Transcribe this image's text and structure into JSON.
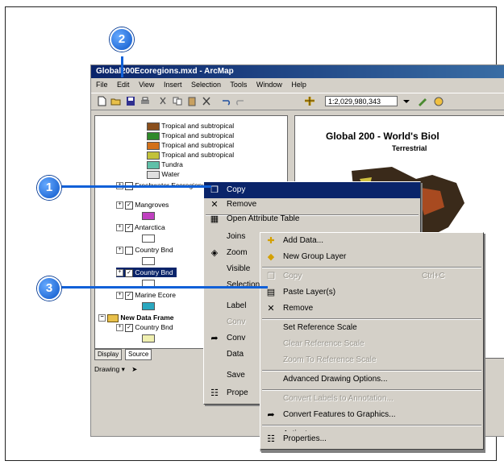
{
  "window": {
    "title": "Global200Ecoregions.mxd - ArcMap",
    "menus": [
      "File",
      "Edit",
      "View",
      "Insert",
      "Selection",
      "Tools",
      "Window",
      "Help"
    ],
    "scale_value": "1:2,029,980,343"
  },
  "toc": {
    "legend_items": [
      {
        "label": "Tropical and subtropical",
        "color": "#8a4f1c"
      },
      {
        "label": "Tropical and subtropical",
        "color": "#2f8a2a"
      },
      {
        "label": "Tropical and subtropical",
        "color": "#d2701a"
      },
      {
        "label": "Tropical and subtropical",
        "color": "#c2c23a"
      },
      {
        "label": "Tundra",
        "color": "#60c0a8"
      },
      {
        "label": "Water",
        "color": "#e0e0e0"
      }
    ],
    "layers": [
      {
        "label": "Freshwater Ecoregions",
        "checked": false
      },
      {
        "label": "Mangroves",
        "checked": true
      },
      {
        "label": "Antarctica",
        "checked": true
      },
      {
        "label": "Country Bnd",
        "checked": false
      },
      {
        "label": "Country Bnd",
        "checked": true
      },
      {
        "label": "Marine Ecore",
        "checked": true
      }
    ],
    "data_frame": "New Data Frame",
    "data_frame_layer": "Country Bnd",
    "tab_display": "Display",
    "tab_source": "Source",
    "drawing_label": "Drawing"
  },
  "layout": {
    "title": "Global 200 - World's Biol",
    "subtitle": "Terrestrial"
  },
  "context_menu": {
    "items": [
      "Copy",
      "Remove",
      "Open Attribute Table",
      "Joins",
      "Zoom",
      "Visible",
      "Selection",
      "Label",
      "Conv",
      "Conv",
      "Data",
      "Save",
      "Prope"
    ]
  },
  "submenu": {
    "items": [
      {
        "label": "Add Data...",
        "disabled": false,
        "icon": "add-data-icon"
      },
      {
        "label": "New Group Layer",
        "disabled": false,
        "icon": "group-layer-icon"
      },
      {
        "label": "Copy",
        "disabled": true,
        "shortcut": "Ctrl+C",
        "icon": "copy-icon"
      },
      {
        "label": "Paste Layer(s)",
        "disabled": false,
        "icon": "paste-icon"
      },
      {
        "label": "Remove",
        "disabled": false,
        "icon": "remove-icon"
      },
      {
        "label": "Set Reference Scale",
        "disabled": false
      },
      {
        "label": "Clear Reference Scale",
        "disabled": true
      },
      {
        "label": "Zoom To Reference Scale",
        "disabled": true
      },
      {
        "label": "Advanced Drawing Options...",
        "disabled": false
      },
      {
        "label": "Convert Labels to Annotation...",
        "disabled": true
      },
      {
        "label": "Convert Features to Graphics...",
        "disabled": false,
        "icon": "convert-icon"
      },
      {
        "label": "Activate",
        "disabled": false
      },
      {
        "label": "Properties...",
        "disabled": false,
        "icon": "properties-icon"
      }
    ]
  },
  "callouts": [
    "1",
    "2",
    "3"
  ],
  "colors": {
    "callout": "#1060d8",
    "titlebar": "#0a246a",
    "menu_bg": "#d4d0c8"
  }
}
